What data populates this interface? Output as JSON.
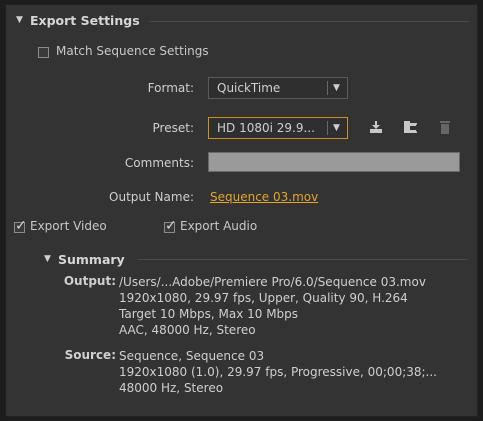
{
  "export_settings": {
    "title": "Export Settings",
    "match_sequence": {
      "label": "Match Sequence Settings",
      "checked": false
    },
    "format": {
      "label": "Format:",
      "value": "QuickTime"
    },
    "preset": {
      "label": "Preset:",
      "value": "HD 1080i 29.9..."
    },
    "comments": {
      "label": "Comments:",
      "value": ""
    },
    "output_name": {
      "label": "Output Name:",
      "value": "Sequence 03.mov"
    },
    "export_video": {
      "label": "Export Video",
      "checked": true
    },
    "export_audio": {
      "label": "Export Audio",
      "checked": true
    },
    "icons": [
      "save-preset-icon",
      "import-preset-icon",
      "delete-preset-icon"
    ]
  },
  "summary": {
    "title": "Summary",
    "output_label": "Output:",
    "output_lines": [
      "/Users/...Adobe/Premiere Pro/6.0/Sequence 03.mov",
      "1920x1080, 29.97 fps, Upper, Quality 90, H.264",
      "Target 10 Mbps, Max 10 Mbps",
      "AAC, 48000 Hz, Stereo"
    ],
    "source_label": "Source:",
    "source_lines": [
      "Sequence, Sequence 03",
      "1920x1080 (1.0), 29.97 fps, Progressive, 00;00;38;...",
      "48000 Hz, Stereo"
    ]
  },
  "colors": {
    "accent_orange": "#e3a52d",
    "panel_bg": "#333333"
  }
}
